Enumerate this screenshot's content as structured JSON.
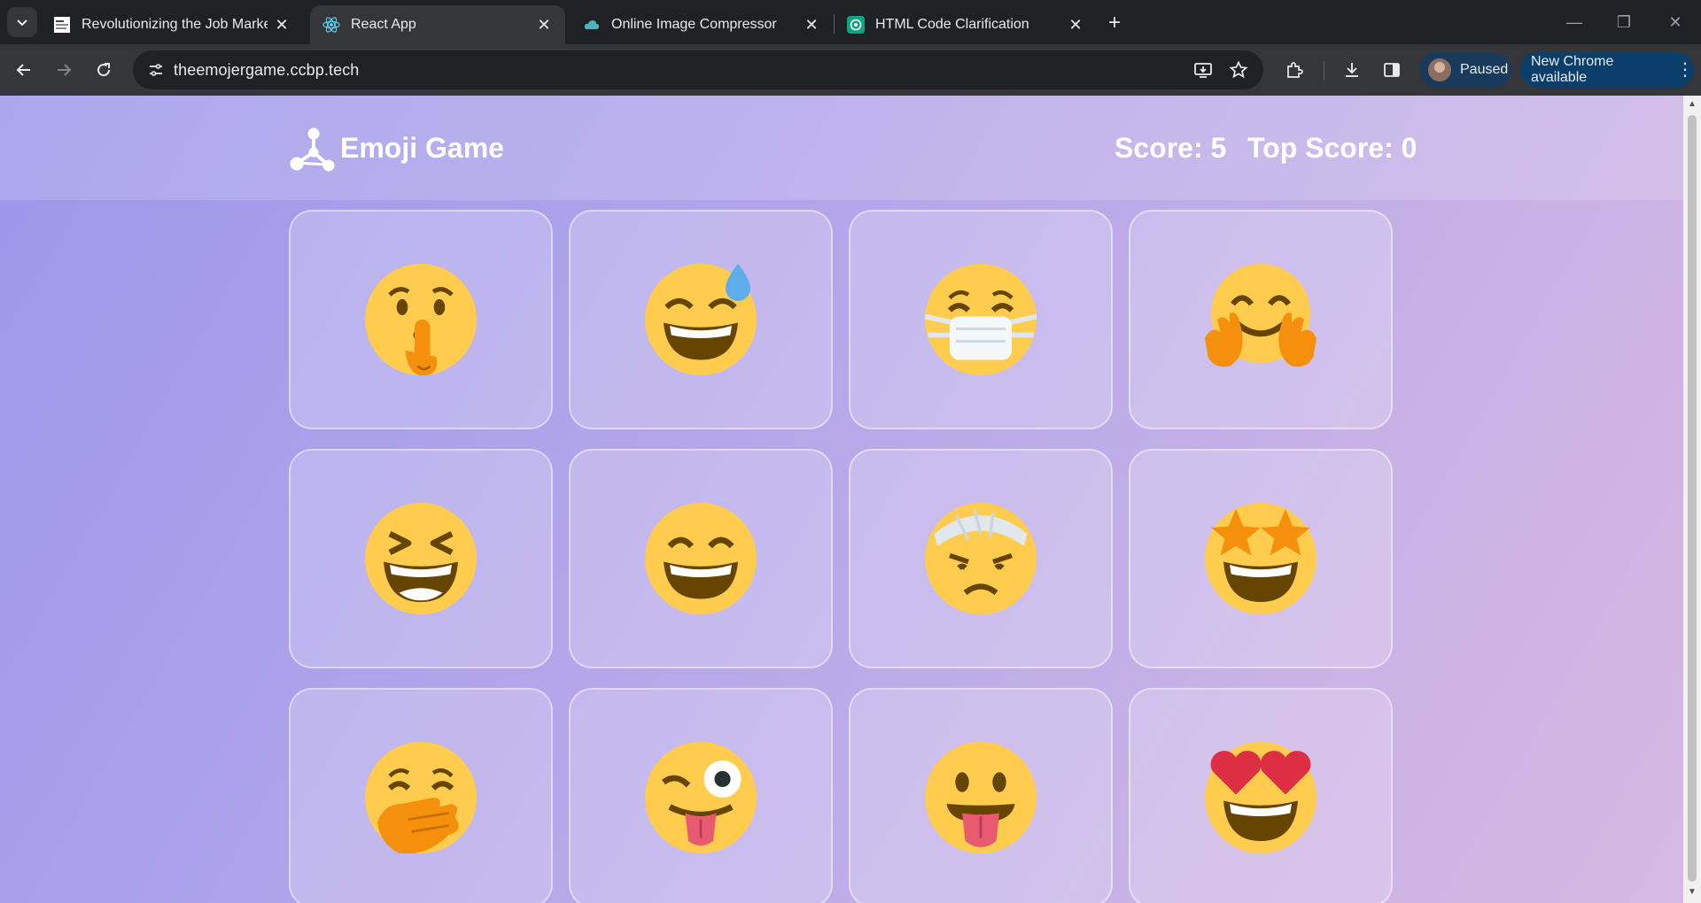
{
  "browser": {
    "tabs": [
      {
        "title": "Revolutionizing the Job Market",
        "favicon": "news-favicon-icon"
      },
      {
        "title": "React App",
        "favicon": "react-icon",
        "active": true
      },
      {
        "title": "Online Image Compressor",
        "favicon": "cloud-icon"
      },
      {
        "title": "HTML Code Clarification",
        "favicon": "chatgpt-icon"
      }
    ],
    "url": "theemojergame.ccbp.tech",
    "profile_label": "Paused",
    "update_label": "New Chrome available"
  },
  "game": {
    "brand": "Emoji Game",
    "score": "Score: 5",
    "top_score": "Top Score: 0"
  },
  "emojis": [
    {
      "name": "shushing-face-emoji"
    },
    {
      "name": "grinning-face-with-sweat-emoji"
    },
    {
      "name": "face-with-medical-mask-emoji"
    },
    {
      "name": "hugging-face-emoji"
    },
    {
      "name": "grinning-squinting-face-emoji"
    },
    {
      "name": "grinning-face-with-smiling-eyes-emoji"
    },
    {
      "name": "face-with-head-bandage-emoji"
    },
    {
      "name": "star-struck-emoji"
    },
    {
      "name": "face-with-hand-over-mouth-emoji"
    },
    {
      "name": "winking-face-with-tongue-emoji"
    },
    {
      "name": "face-with-tongue-emoji"
    },
    {
      "name": "smiling-face-with-heart-eyes-emoji"
    }
  ],
  "colors": {
    "emoji_yellow": "#FFCC4D",
    "emoji_dark": "#664500",
    "hand_orange": "#F4900C",
    "background_start": "#9c97ea",
    "background_end": "#d7b8e2"
  }
}
